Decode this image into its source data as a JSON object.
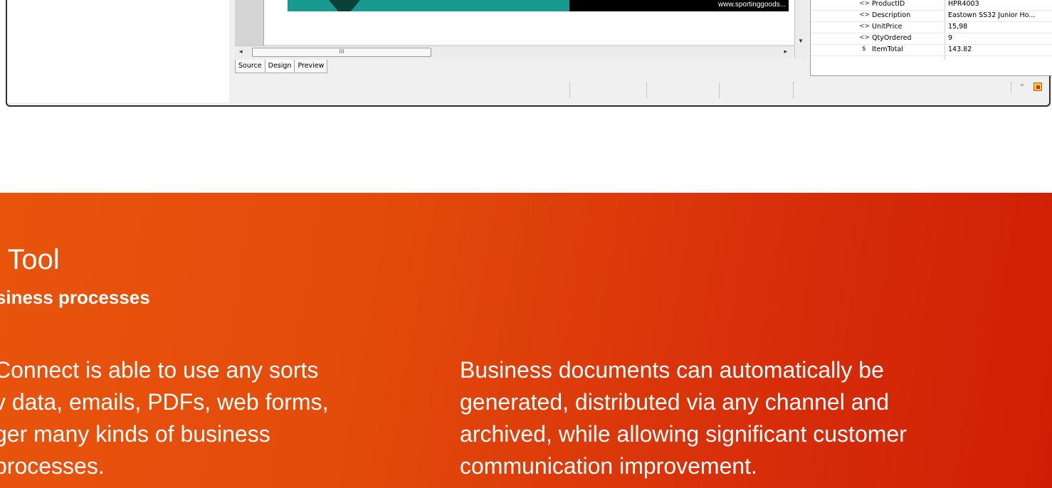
{
  "app": {
    "doc_preview_url": "www.sportinggoods...",
    "scrollbar_grip": "III",
    "tabs": [
      {
        "label": "Source",
        "active": false
      },
      {
        "label": "Design",
        "active": true
      },
      {
        "label": "Preview",
        "active": false
      }
    ],
    "properties": [
      {
        "icon": "element-icon",
        "glyph": "<>",
        "name": "ProductID",
        "value": "HPR4003"
      },
      {
        "icon": "element-icon",
        "glyph": "<>",
        "name": "Description",
        "value": "Eastown SS32 Junior Ho..."
      },
      {
        "icon": "element-icon",
        "glyph": "<>",
        "name": "UnitPrice",
        "value": "15,98"
      },
      {
        "icon": "element-icon",
        "glyph": "<>",
        "name": "QtyOrdered",
        "value": "9"
      },
      {
        "icon": "expression-icon",
        "glyph": "$",
        "name": "ItemTotal",
        "value": "143.82"
      }
    ]
  },
  "banner": {
    "title": "v Tool",
    "subtitle": "usiness processes",
    "left_paragraph": [
      "Connect is able to use any sorts",
      "v data, emails, PDFs, web forms,",
      "ger many kinds of business",
      "processes."
    ],
    "right_paragraph": [
      "Business documents can automatically be",
      "generated, distributed via any channel and",
      "archived, while allowing significant customer",
      "communication improvement."
    ]
  },
  "colors": {
    "banner_start": "#e8540c",
    "banner_end": "#cf1e05",
    "doc_teal": "#169b8e"
  }
}
